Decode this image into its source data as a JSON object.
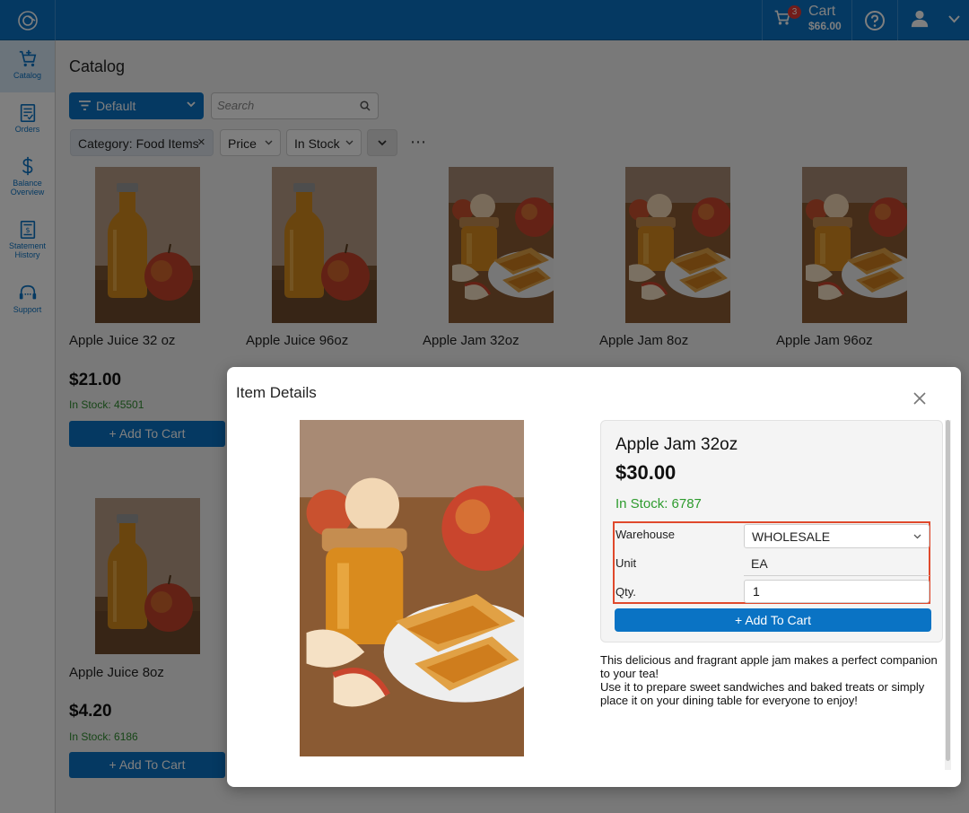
{
  "topbar": {
    "cart_label": "Cart",
    "cart_total": "$66.00",
    "cart_count": "3"
  },
  "sidebar": {
    "items": [
      {
        "label": "Catalog",
        "icon": "cart-plus-icon"
      },
      {
        "label": "Orders",
        "icon": "orders-icon"
      },
      {
        "label": "Balance Overview",
        "icon": "dollar-icon"
      },
      {
        "label": "Statement History",
        "icon": "statement-icon"
      },
      {
        "label": "Support",
        "icon": "headset-icon"
      }
    ]
  },
  "catalog": {
    "title": "Catalog",
    "sort_label": "Default",
    "search_placeholder": "Search",
    "filters": {
      "category": "Category: Food Items",
      "price": "Price",
      "stock": "In Stock"
    },
    "add_label": "Add To Cart",
    "products": [
      {
        "name": "Apple Juice 32 oz",
        "price": "$21.00",
        "stock": "In Stock: 45501",
        "image": "juice"
      },
      {
        "name": "Apple Juice 96oz",
        "image": "juice"
      },
      {
        "name": "Apple Jam 32oz",
        "image": "jam"
      },
      {
        "name": "Apple Jam 8oz",
        "image": "jam"
      },
      {
        "name": "Apple Jam 96oz",
        "image": "jam"
      },
      {
        "name": "Apple Juice 8oz",
        "price": "$4.20",
        "stock": "In Stock: 6186",
        "image": "juice"
      }
    ]
  },
  "modal": {
    "title": "Item Details",
    "name": "Apple Jam 32oz",
    "price": "$30.00",
    "stock": "In Stock: 6787",
    "warehouse_label": "Warehouse",
    "warehouse_value": "WHOLESALE",
    "unit_label": "Unit",
    "unit_value": "EA",
    "qty_label": "Qty.",
    "qty_value": "1",
    "add_label": "Add To Cart",
    "description": [
      "This delicious and fragrant apple jam makes a perfect companion to your tea!",
      "Use it to prepare sweet sandwiches and baked treats or simply place it on your dining table for everyone to enjoy!"
    ]
  },
  "colors": {
    "primary": "#0a73c4",
    "stock_green": "#2e8b2e",
    "highlight": "#e0492c"
  }
}
